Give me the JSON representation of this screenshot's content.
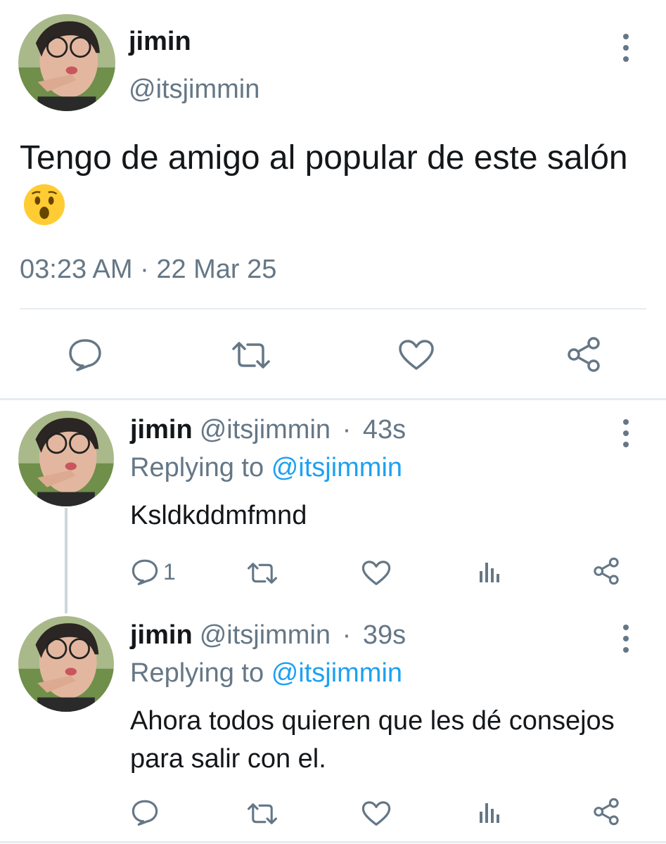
{
  "main_tweet": {
    "name": "jimin",
    "handle": "@itsjimmin",
    "text": "Tengo de amigo al popular de este salón",
    "emoji": "hushed-face-emoji",
    "timestamp": "03:23 AM · 22 Mar 25",
    "actions": [
      "reply-icon",
      "retweet-icon",
      "like-icon",
      "share-icon"
    ]
  },
  "replies": [
    {
      "name": "jimin",
      "handle": "@itsjimmin",
      "time_sep": "·",
      "time": "43s",
      "replying_prefix": "Replying to",
      "replying_to": "@itsjimmin",
      "text": "Ksldkddmfmnd",
      "reply_count": "1"
    },
    {
      "name": "jimin",
      "handle": "@itsjimmin",
      "time_sep": "·",
      "time": "39s",
      "replying_prefix": "Replying to",
      "replying_to": "@itsjimmin",
      "text": "Ahora todos quieren que les dé consejos para salir con el.",
      "reply_count": ""
    }
  ],
  "colors": {
    "text": "#14171a",
    "secondary": "#657786",
    "link": "#1da1f2",
    "divider": "#e6ecf0"
  }
}
